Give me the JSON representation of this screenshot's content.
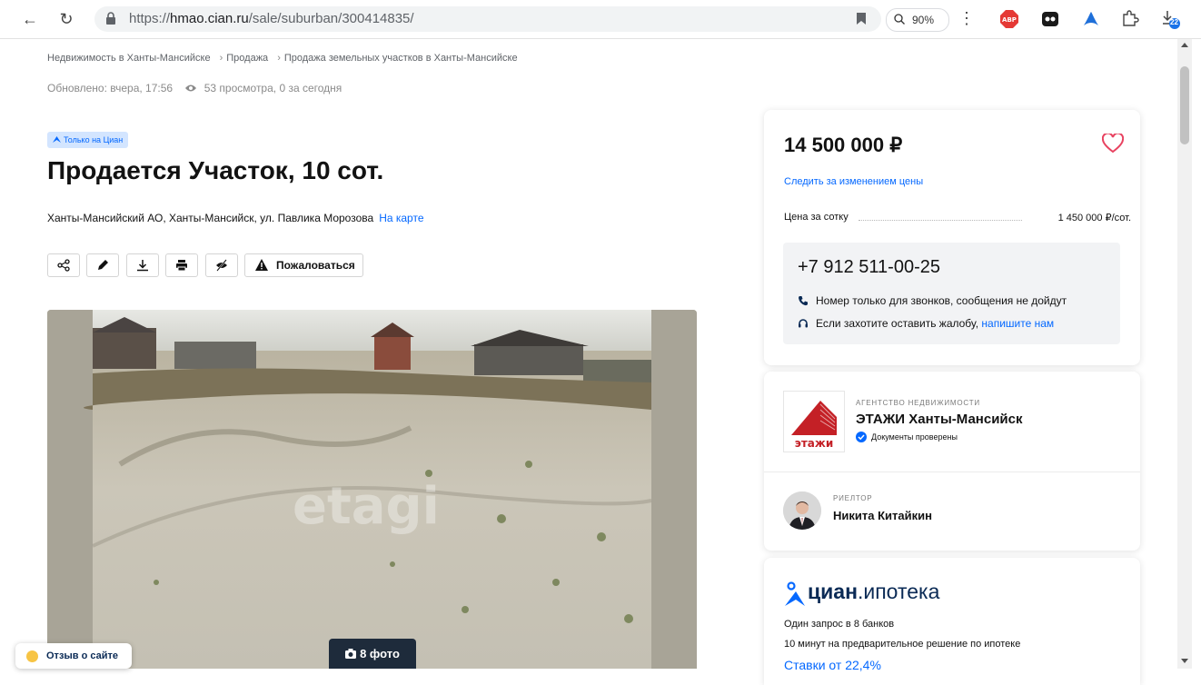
{
  "browser": {
    "url_prefix": "https://",
    "url_host": "hmao.cian.ru",
    "url_path": "/sale/suburban/300414835/",
    "zoom": "90%",
    "downloads_badge": "22"
  },
  "breadcrumb": {
    "items": [
      "Недвижимость в Ханты-Мансийске",
      "Продажа",
      "Продажа земельных участков в Ханты-Мансийске"
    ]
  },
  "meta": {
    "updated": "Обновлено: вчера, 17:56",
    "views": "53 просмотра, 0 за сегодня"
  },
  "badge": {
    "label": "Только на Циан"
  },
  "title": "Продается Участок, 10 сот.",
  "address": {
    "text": "Ханты-Мансийский АО, Ханты-Мансийск, ул. Павлика Морозова",
    "map_link": "На карте"
  },
  "actions": {
    "icons": [
      "share-icon",
      "edit-icon",
      "download-icon",
      "print-icon",
      "hide-icon"
    ],
    "complain_label": "Пожаловаться"
  },
  "photo": {
    "watermark": "etagi",
    "counter": "8 фото"
  },
  "feedback": {
    "label": "Отзыв о сайте"
  },
  "price_card": {
    "price": "14 500 000 ₽",
    "follow_link": "Следить за изменением цены",
    "price_per_sotka_label": "Цена за сотку",
    "price_per_sotka_value": "1 450 000 ₽/сот.",
    "phone": "+7 912 511-00-25",
    "phone_note": "Номер только для звонков, сообщения не дойдут",
    "complaint_note": "Если захотите оставить жалобу,",
    "complaint_link": "напишите нам"
  },
  "agent_card": {
    "agency_kicker": "АГЕНТСТВО НЕДВИЖИМОСТИ",
    "agency_name": "ЭТАЖИ Ханты-Мансийск",
    "agency_logo_text": "этажи",
    "verified": "Документы проверены",
    "realtor_kicker": "РИЕЛТОР",
    "realtor_name": "Никита Китайкин"
  },
  "mortgage_card": {
    "brand": "циан",
    "product": ".ипотека",
    "line1": "Один запрос в 8 банков",
    "line2": "10 минут на предварительное решение по ипотеке",
    "rate": "Ставки от 22,4%"
  },
  "colors": {
    "accent": "#0468ff",
    "heart": "#e84260",
    "agency_red": "#c42026",
    "dark": "#121212"
  }
}
